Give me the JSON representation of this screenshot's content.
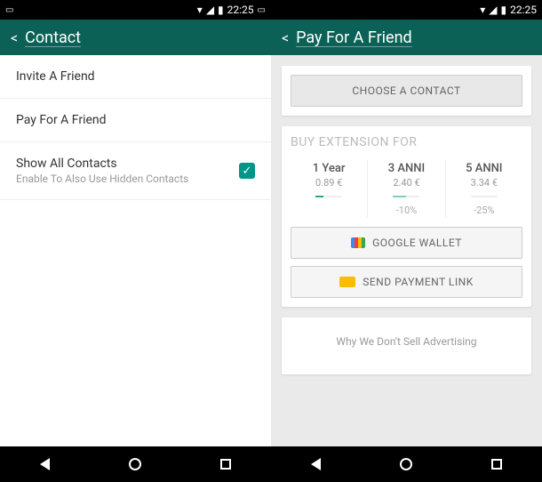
{
  "status": {
    "time": "22:25"
  },
  "left": {
    "header_title": "Contact",
    "items": {
      "invite": "Invite A Friend",
      "pay": "Pay For A Friend",
      "show_all": "Show All Contacts",
      "show_all_sub": "Enable To Also Use Hidden Contacts"
    }
  },
  "right": {
    "header_title": "Pay For A Friend",
    "choose_contact": "CHOOSE A CONTACT",
    "buy_title": "BUY EXTENSION FOR",
    "plans": [
      {
        "name": "1 Year",
        "price": "0.89 €",
        "discount": ""
      },
      {
        "name": "3 ANNI",
        "price": "2.40 €",
        "discount": "-10%"
      },
      {
        "name": "5 ANNI",
        "price": "3.34 €",
        "discount": "-25%"
      }
    ],
    "google_wallet": "GOOGLE WALLET",
    "send_link": "SEND PAYMENT LINK",
    "ad_text": "Why We Don't Sell Advertising"
  }
}
